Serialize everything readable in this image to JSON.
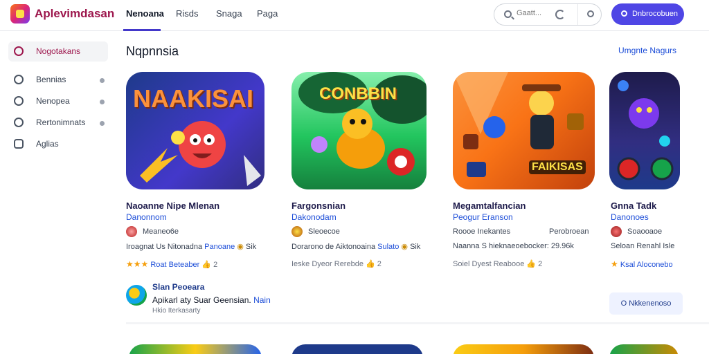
{
  "header": {
    "app_title": "Aplevimdasan",
    "tabs": [
      {
        "label": "Nenoana",
        "active": true
      },
      {
        "label": "Risds",
        "active": false
      },
      {
        "label": "Snaga",
        "active": false
      },
      {
        "label": "Paga",
        "active": false
      }
    ],
    "search": {
      "placeholder": "Gaatt..."
    },
    "signin_label": "Dnbrocobuen"
  },
  "sidebar": {
    "items": [
      {
        "label": "Nogotakans",
        "icon": "home-icon",
        "active": true,
        "dot": false
      },
      {
        "label": "Bennias",
        "icon": "users-icon",
        "active": false,
        "dot": true
      },
      {
        "label": "Nenopea",
        "icon": "cloud-icon",
        "active": false,
        "dot": true
      },
      {
        "label": "Rertonimnats",
        "icon": "location-icon",
        "active": false,
        "dot": true
      },
      {
        "label": "Aglias",
        "icon": "grid-icon",
        "active": false,
        "dot": false
      }
    ]
  },
  "main": {
    "section_title": "Nqpnnsia",
    "section_link": "Umgnte Nagurs",
    "apps": [
      {
        "banner_text": "NAAKISAI",
        "name": "Naoanne Nipe Mlenan",
        "developer": "Danonnom",
        "avatar_text": "Meaneo6e",
        "meta_text": "Iroagnat Us Nitonadna",
        "meta_link": "Panoane",
        "meta_extra": "Sik",
        "rating_link": "Roat Beteaber",
        "rating_count": "2"
      },
      {
        "banner_text": "CONBBIN",
        "name": "Fargonsnian",
        "developer": "Dakonodam",
        "avatar_text": "Sleoecoe",
        "meta_text": "Dorarono de Aiktonoaina",
        "meta_link": "Sulato",
        "meta_extra": "Sik",
        "rating_link": "Ieske Dyeor Rerebde",
        "rating_count": "2"
      },
      {
        "banner_text": "FAIKISAS",
        "name": "Megamtalfancian",
        "developer": "Peogur Eranson",
        "avatar_text": "Roooe Inekantes",
        "avatar_extra": "Perobroean",
        "meta_text": "Naanna S hieknaeoebocker:",
        "meta_extra": "29.96k",
        "rating_link": "Soiel Dyest Reabooe",
        "rating_count": "2"
      },
      {
        "banner_text": "",
        "name": "Gnna Tadk",
        "developer": "Danonoes",
        "avatar_text": "Soaooaoe",
        "meta_text": "Seloan Renahl Isle",
        "rating_link": "Ksal Aloconebo"
      }
    ],
    "promo": {
      "title": "Slan Peoeara",
      "body": "Apikarl aty Suar Geensian.",
      "body_link": "Nain",
      "sub": "Hkio Iterkasarty",
      "button_label": "O Nkkenenoso"
    }
  },
  "colors": {
    "accent": "#4f46e5",
    "link": "#1d4ed8",
    "brand": "#9d174d"
  }
}
